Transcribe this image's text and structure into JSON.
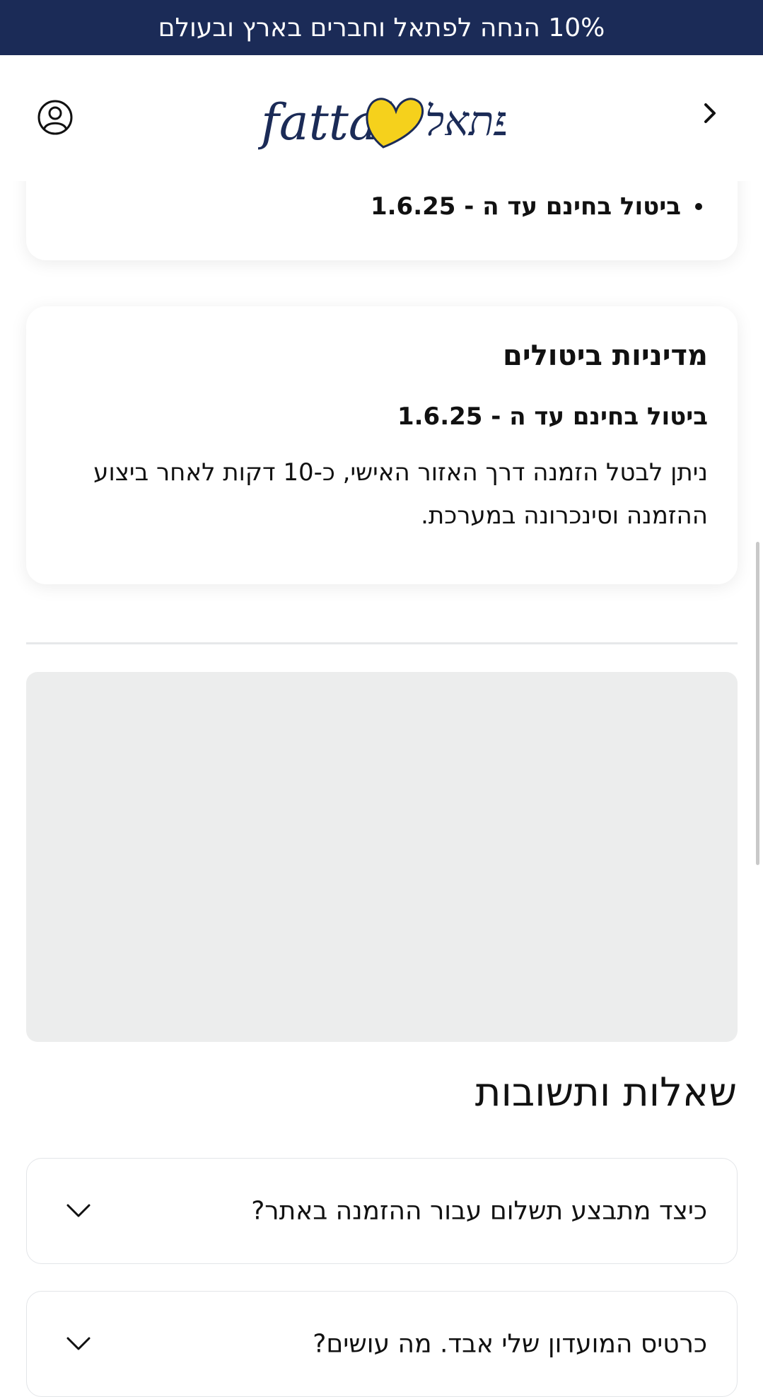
{
  "promo_banner": {
    "text": "10% הנחה לפתאל וחברים בארץ ובעולם"
  },
  "header": {
    "logo_text_latin": "fattal",
    "logo_text_hebrew": "פתאל",
    "logo_heart_color": "#f5d11c",
    "brand_color": "#1b2b57"
  },
  "cancellation_summary": {
    "bullet": "ביטול בחינם עד ה - 1.6.25"
  },
  "cancellation_policy": {
    "title": "מדיניות ביטולים",
    "subtitle": "ביטול בחינם עד ה - 1.6.25",
    "description": "ניתן לבטל הזמנה דרך האזור האישי, כ-10 דקות לאחר ביצוע ההזמנה וסינכרונה במערכת."
  },
  "faq": {
    "title": "שאלות ותשובות",
    "items": [
      {
        "question": "כיצד מתבצע תשלום עבור ההזמנה באתר?"
      },
      {
        "question": "כרטיס המועדון שלי אבד. מה עושים?"
      }
    ]
  },
  "icons": {
    "back": "chevron-right-icon",
    "account": "user-circle-icon",
    "expand": "chevron-down-icon"
  }
}
